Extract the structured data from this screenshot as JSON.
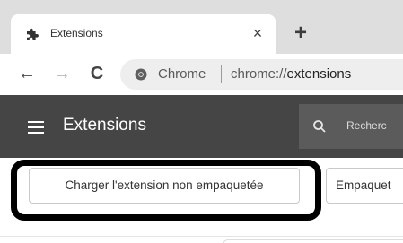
{
  "tab": {
    "title": "Extensions",
    "close_glyph": "×",
    "new_tab_glyph": "+"
  },
  "toolbar": {
    "back_glyph": "←",
    "forward_glyph": "→",
    "reload_glyph": "C",
    "omnibox_chrome_label": "Chrome",
    "url_scheme": "chrome://",
    "url_path": "extensions"
  },
  "header": {
    "title": "Extensions",
    "search_placeholder": "Recherc"
  },
  "actions": {
    "load_unpacked_label": "Charger l'extension non empaquetée",
    "pack_label": "Empaquet"
  },
  "icons": {
    "favicon": "puzzle-icon",
    "omnibox": "chrome-logo-icon",
    "menu": "hamburger-icon",
    "search": "search-icon"
  },
  "colors": {
    "header_bg": "#454545",
    "highlight": "#000000"
  }
}
